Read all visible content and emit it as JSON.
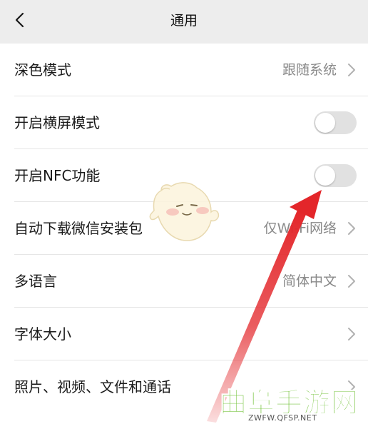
{
  "header": {
    "title": "通用"
  },
  "settings": [
    {
      "label": "深色模式",
      "value": "跟随系统",
      "control": "chevron"
    },
    {
      "label": "开启横屏模式",
      "value": "",
      "control": "toggle",
      "state": "off"
    },
    {
      "label": "开启NFC功能",
      "value": "",
      "control": "toggle",
      "state": "off"
    },
    {
      "label": "自动下载微信安装包",
      "value": "仅Wi-Fi网络",
      "control": "chevron"
    },
    {
      "label": "多语言",
      "value": "简体中文",
      "control": "chevron"
    },
    {
      "label": "字体大小",
      "value": "",
      "control": "chevron"
    },
    {
      "label": "照片、视频、文件和通话",
      "value": "",
      "control": "chevron"
    }
  ],
  "watermark": {
    "logo_text": "曲阜手游网",
    "url": "ZWFW.QFSP.NET"
  },
  "colors": {
    "background": "#ededed",
    "card": "#ffffff",
    "toggle_off": "#e1e1e1",
    "annotation_arrow": "#e3262a",
    "watermark_green": "#6cbf2f"
  },
  "icons": {
    "back": "back-chevron-icon",
    "row_chevron": "chevron-right-icon"
  }
}
